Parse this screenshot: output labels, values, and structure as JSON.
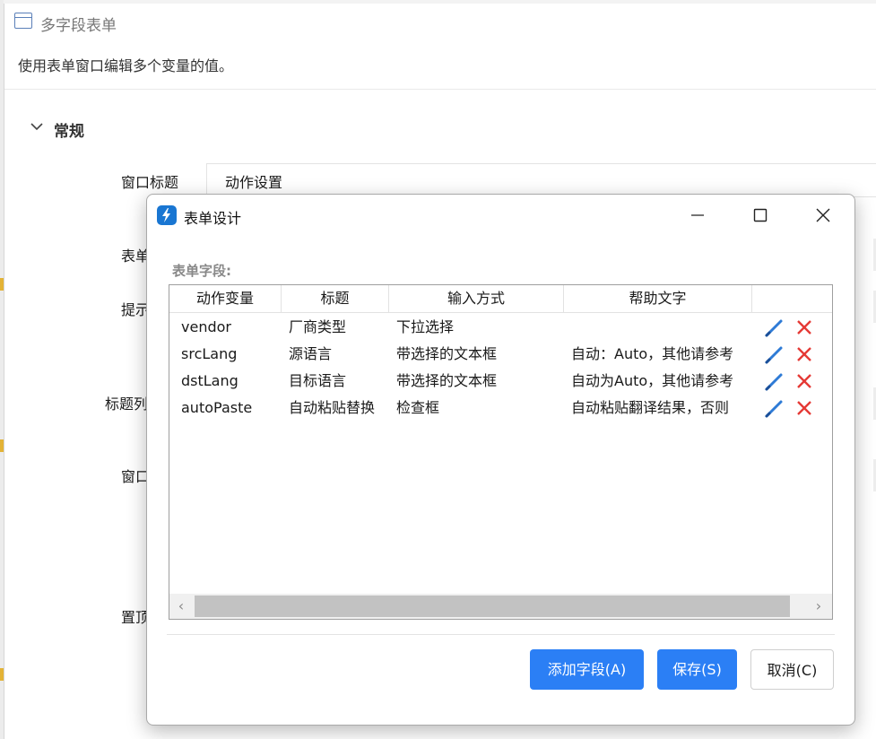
{
  "background_window": {
    "title": "多字段表单",
    "description": "使用表单窗口编辑多个变量的值。",
    "section_title": "常规",
    "labels": [
      "窗口标题",
      "表单",
      "提示",
      "标题列",
      "窗口",
      "置顶"
    ],
    "window_title_value": "动作设置"
  },
  "dialog": {
    "title": "表单设计",
    "fields_label": "表单字段:",
    "columns": [
      "动作变量",
      "标题",
      "输入方式",
      "帮助文字"
    ],
    "rows": [
      {
        "variable": "vendor",
        "title": "厂商类型",
        "input": "下拉选择",
        "help": ""
      },
      {
        "variable": "srcLang",
        "title": "源语言",
        "input": "带选择的文本框",
        "help": "自动：Auto，其他请参考"
      },
      {
        "variable": "dstLang",
        "title": "目标语言",
        "input": "带选择的文本框",
        "help": "自动为Auto，其他请参考"
      },
      {
        "variable": "autoPaste",
        "title": "自动粘贴替换",
        "input": "检查框",
        "help": "自动粘贴翻译结果，否则"
      }
    ],
    "buttons": {
      "add": "添加字段(A)",
      "save": "保存(S)",
      "cancel": "取消(C)"
    }
  },
  "icons": {
    "window": "window-icon",
    "app": "lightning-app-icon",
    "edit": "pencil-icon",
    "delete": "red-x-icon",
    "chevron": "chevron-down-icon"
  },
  "colors": {
    "primary_button": "#2b7ff5",
    "delete_icon": "#e53935",
    "edit_icon": "#2e7bd6",
    "app_icon": "#1976d2"
  }
}
